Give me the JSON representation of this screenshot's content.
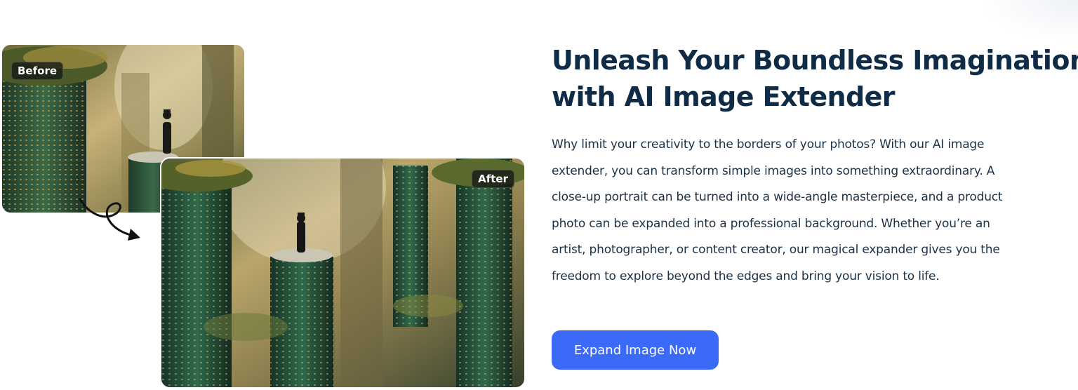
{
  "comparison": {
    "before_label": "Before",
    "after_label": "After"
  },
  "headline": {
    "line1": "Unleash Your Boundless Imagination",
    "line2": "with AI Image Extender"
  },
  "description": {
    "lines": [
      "Why limit your creativity to the borders of your photos? With our AI image",
      "extender, you can transform simple images into something extraordinary. A",
      "close-up portrait can be turned into a wide-angle masterpiece, and a product",
      "photo can be expanded into a professional background. Whether you’re an",
      "artist, photographer, or content creator, our magical expander gives you the",
      "freedom to explore beyond the edges and bring your vision to life."
    ]
  },
  "cta": {
    "label": "Expand Image Now"
  },
  "colors": {
    "heading": "#0f2b45",
    "body": "#1d3144",
    "button": "#3a6af6"
  },
  "icons": {
    "arrow": "curly-arrow-icon"
  }
}
